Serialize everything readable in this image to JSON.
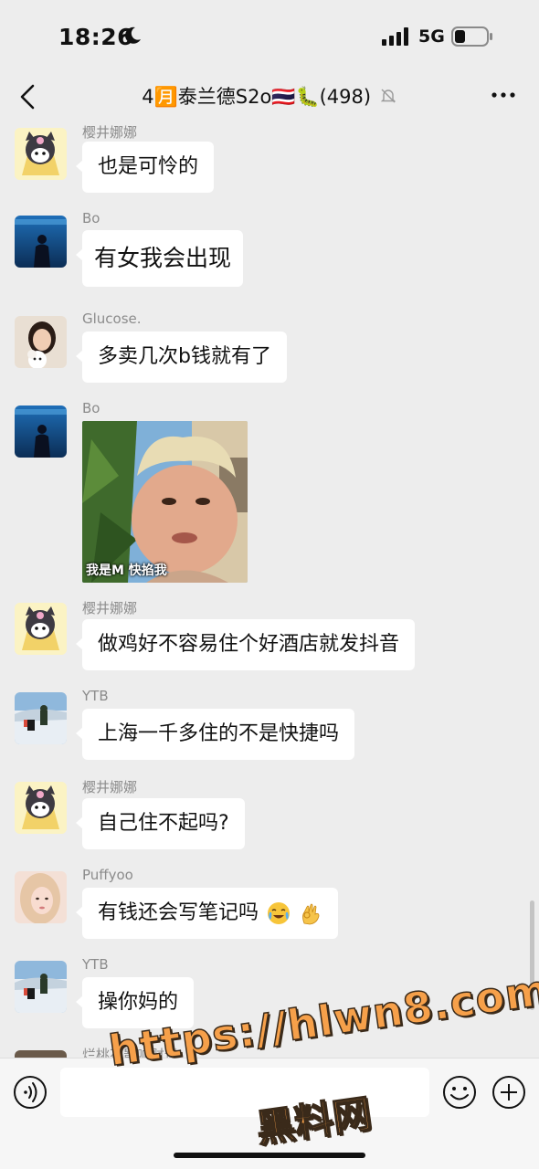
{
  "status_bar": {
    "time": "18:26",
    "network": "5G"
  },
  "header": {
    "title": "4🈷️泰兰德S2o🇹🇭🐛(498)"
  },
  "messages": [
    {
      "sender": "樱井娜娜",
      "text": "也是可怜的"
    },
    {
      "sender": "Bo",
      "text": "有女我会出现"
    },
    {
      "sender": "Glucose.",
      "text": "多卖几次b钱就有了"
    },
    {
      "sender": "Bo",
      "image_caption": "我是M 快掐我"
    },
    {
      "sender": "樱井娜娜",
      "text": "做鸡好不容易住个好酒店就发抖音"
    },
    {
      "sender": "YTB",
      "text": "上海一千多住的不是快捷吗"
    },
    {
      "sender": "樱井娜娜",
      "text": "自己住不起吗?"
    },
    {
      "sender": "Puffyoo",
      "text": "有钱还会写笔记吗"
    },
    {
      "sender": "YTB",
      "text": "操你妈的"
    },
    {
      "sender": "烂桃花影响财运"
    }
  ],
  "input_bar": {
    "placeholder": ""
  },
  "watermark": {
    "url": "https://hlwn8.com",
    "name": "黑料网"
  },
  "colors": {
    "background": "#ededed",
    "bubble": "#ffffff",
    "sender_name": "#8c8c8c",
    "watermark": "#f6a04a"
  }
}
